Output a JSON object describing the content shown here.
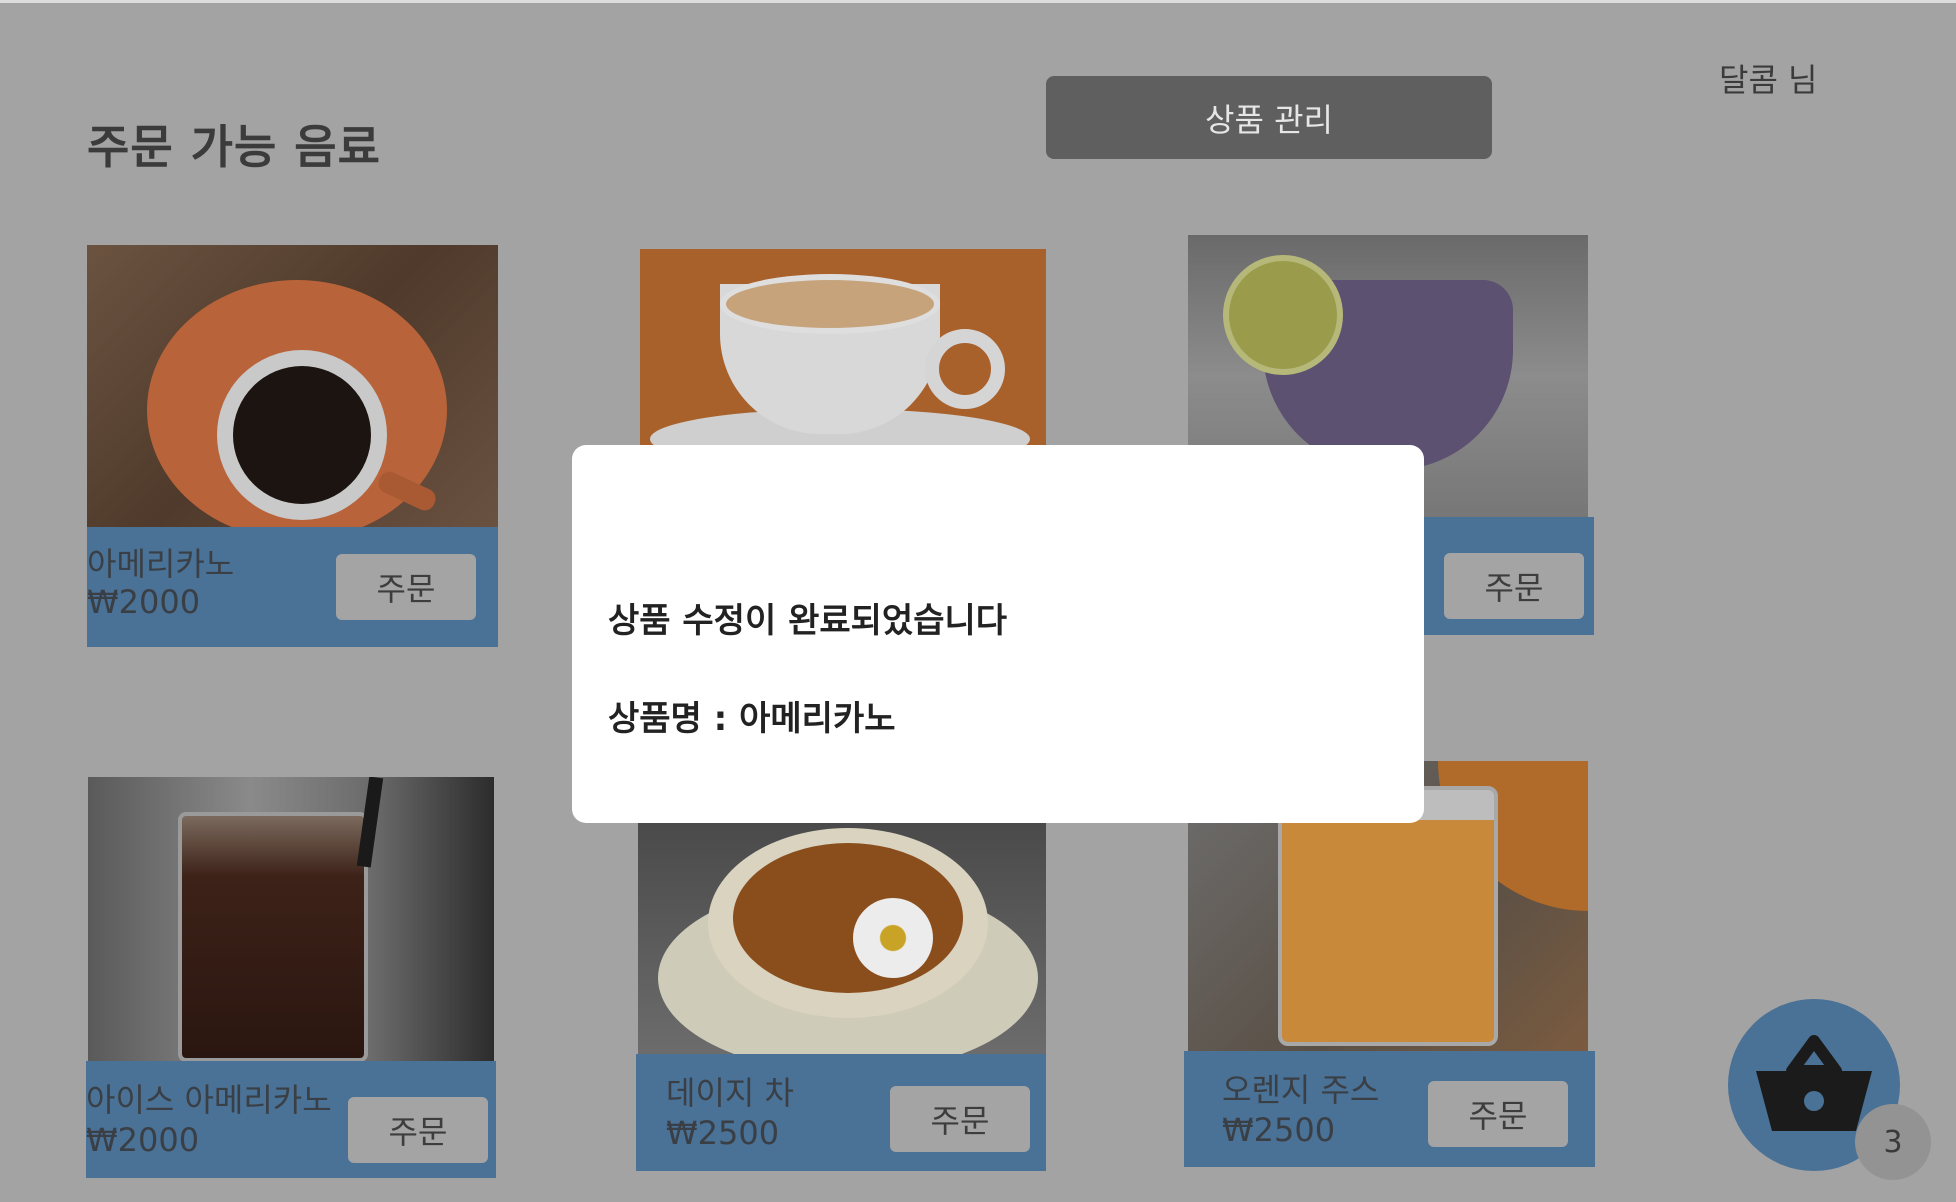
{
  "header": {
    "title": "주문 가능 음료",
    "manage_label": "상품 관리",
    "user": "달콤 님"
  },
  "products": [
    {
      "name": "아메리카노",
      "price": "₩2000",
      "order": "주문",
      "image": "hot-americano"
    },
    {
      "name": "",
      "price": "",
      "order": "",
      "image": "cappuccino"
    },
    {
      "name": "",
      "price": "",
      "order": "주문",
      "image": "blueberry-smoothie"
    },
    {
      "name": "아이스 아메리카노",
      "price": "₩2000",
      "order": "주문",
      "image": "iced-americano"
    },
    {
      "name": "데이지 차",
      "price": "₩2500",
      "order": "주문",
      "image": "daisy-tea"
    },
    {
      "name": "오렌지 주스",
      "price": "₩2500",
      "order": "주문",
      "image": "orange-juice"
    }
  ],
  "cart": {
    "icon": "basket-icon",
    "count": "3"
  },
  "modal": {
    "message": "상품 수정이 완료되었습니다",
    "product_line": "상품명 : 아메리카노"
  },
  "colors": {
    "background_dimmed": "#a3a3a3",
    "card_info": "#4a7196",
    "manage_button": "#5f5f5f",
    "modal": "#ffffff"
  }
}
